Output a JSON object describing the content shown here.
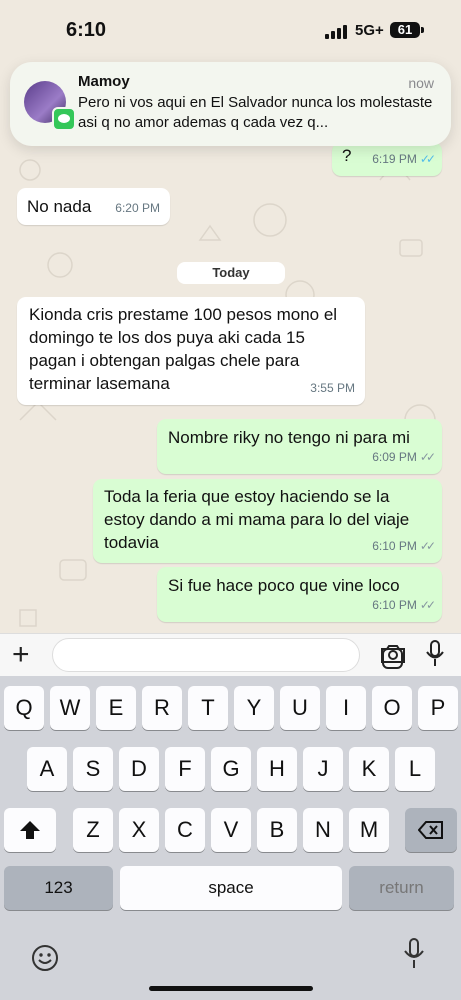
{
  "status_bar": {
    "time": "6:10",
    "network": "5G+",
    "battery": "61"
  },
  "notification": {
    "sender": "Mamoy",
    "time": "now",
    "message": "Pero ni vos aqui en El Salvador nunca los molestaste asi q no amor ademas q cada vez q..."
  },
  "messages": [
    {
      "dir": "out",
      "text": "?",
      "time": "6:19 PM",
      "status": "read"
    },
    {
      "dir": "in",
      "text": "No nada",
      "time": "6:20 PM"
    },
    {
      "dir": "in",
      "text": "Kionda cris prestame 100 pesos mono el domingo te los dos puya aki cada 15 pagan i obtengan palgas chele para terminar lasemana",
      "time": "3:55 PM"
    },
    {
      "dir": "out",
      "text": "Nombre riky no tengo ni para mi",
      "time": "6:09 PM",
      "status": "delivered"
    },
    {
      "dir": "out",
      "text": "Toda la feria que estoy haciendo se la estoy dando a mi mama para lo del viaje todavia",
      "time": "6:10 PM",
      "status": "delivered"
    },
    {
      "dir": "out",
      "text": "Si fue hace poco que vine loco",
      "time": "6:10 PM",
      "status": "delivered"
    }
  ],
  "date_separator": "Today",
  "input": {
    "placeholder": ""
  },
  "icons": [
    "signal-icon",
    "plus-icon",
    "sticker-icon",
    "camera-icon",
    "mic-icon",
    "emoji-icon",
    "shift-icon",
    "delete-icon"
  ],
  "colors": {
    "outgoing": "#d9fdd3",
    "incoming": "#ffffff",
    "read_ticks": "#53bdeb",
    "delivered_ticks": "#8696a0"
  },
  "keyboard": {
    "row1": [
      "Q",
      "W",
      "E",
      "R",
      "T",
      "Y",
      "U",
      "I",
      "O",
      "P"
    ],
    "row2": [
      "A",
      "S",
      "D",
      "F",
      "G",
      "H",
      "J",
      "K",
      "L"
    ],
    "row3": [
      "Z",
      "X",
      "C",
      "V",
      "B",
      "N",
      "M"
    ],
    "k123": "123",
    "space": "space",
    "return": "return"
  }
}
